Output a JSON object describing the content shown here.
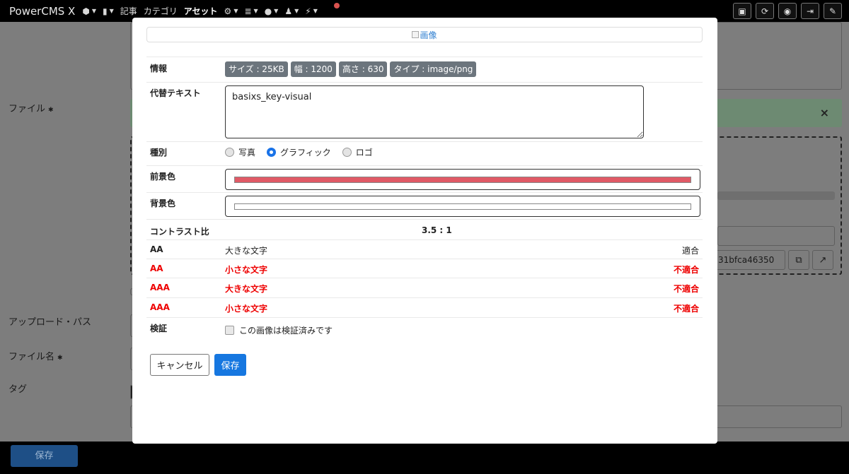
{
  "app": {
    "brand": "PowerCMS X",
    "nav": {
      "article": "記事",
      "category": "カテゴリ",
      "asset": "アセット"
    }
  },
  "background": {
    "labels": {
      "file": "ファイル",
      "upload_path": "アップロード・パス",
      "file_name": "ファイル名",
      "tag": "タグ"
    },
    "hash_text": "31bfca46350",
    "alert_close": "×",
    "footer_save": "保存"
  },
  "modal": {
    "preview_alt": "画像",
    "info": {
      "label": "情報",
      "badges": [
        "サイズ : 25KB",
        "幅 : 1200",
        "高さ : 630",
        "タイプ : image/png"
      ]
    },
    "alt_text": {
      "label": "代替テキスト",
      "value": "basixs_key-visual"
    },
    "kind": {
      "label": "種別",
      "options": [
        "写真",
        "グラフィック",
        "ロゴ"
      ],
      "selected": "グラフィック"
    },
    "foreground": {
      "label": "前景色",
      "color": "#e05a66"
    },
    "background": {
      "label": "背景色",
      "color": "#ffffff"
    },
    "contrast": {
      "label": "コントラスト比",
      "value": "3.5 : 1",
      "rows": [
        {
          "level": "AA",
          "desc": "大きな文字",
          "result": "適合",
          "pass": true
        },
        {
          "level": "AA",
          "desc": "小さな文字",
          "result": "不適合",
          "pass": false
        },
        {
          "level": "AAA",
          "desc": "大きな文字",
          "result": "不適合",
          "pass": false
        },
        {
          "level": "AAA",
          "desc": "小さな文字",
          "result": "不適合",
          "pass": false
        }
      ]
    },
    "verify": {
      "label": "検証",
      "checkbox_label": "この画像は検証済みです",
      "checked": false
    },
    "buttons": {
      "cancel": "キャンセル",
      "save": "保存"
    }
  }
}
